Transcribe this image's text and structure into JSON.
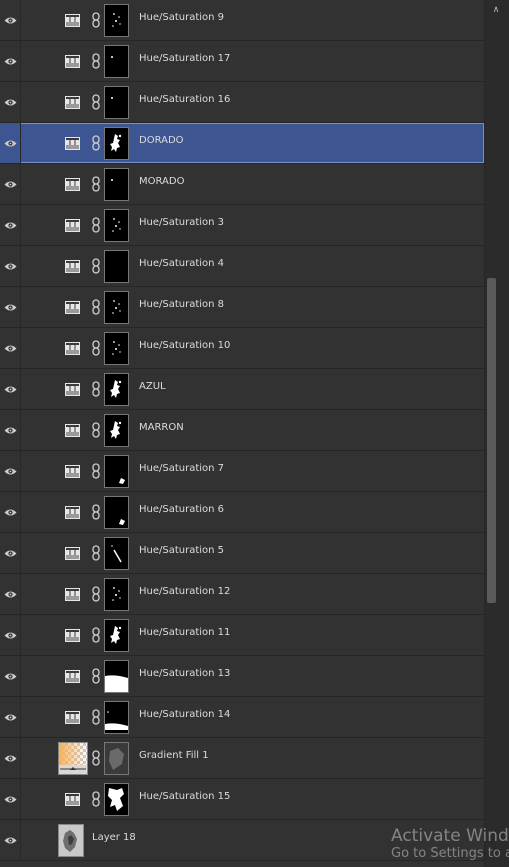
{
  "layers": [
    {
      "name": "Hue/Saturation 9",
      "kind": "adjustment",
      "selected": false,
      "mask": "specks"
    },
    {
      "name": "Hue/Saturation 17",
      "kind": "adjustment",
      "selected": false,
      "mask": "dot"
    },
    {
      "name": "Hue/Saturation 16",
      "kind": "adjustment",
      "selected": false,
      "mask": "dot"
    },
    {
      "name": "DORADO",
      "kind": "adjustment",
      "selected": true,
      "mask": "figure"
    },
    {
      "name": "MORADO",
      "kind": "adjustment",
      "selected": false,
      "mask": "dot"
    },
    {
      "name": "Hue/Saturation 3",
      "kind": "adjustment",
      "selected": false,
      "mask": "specks"
    },
    {
      "name": "Hue/Saturation 4",
      "kind": "adjustment",
      "selected": false,
      "mask": "none"
    },
    {
      "name": "Hue/Saturation 8",
      "kind": "adjustment",
      "selected": false,
      "mask": "specks"
    },
    {
      "name": "Hue/Saturation 10",
      "kind": "adjustment",
      "selected": false,
      "mask": "specks"
    },
    {
      "name": "AZUL",
      "kind": "adjustment",
      "selected": false,
      "mask": "figure"
    },
    {
      "name": "MARRON",
      "kind": "adjustment",
      "selected": false,
      "mask": "figure"
    },
    {
      "name": "Hue/Saturation 7",
      "kind": "adjustment",
      "selected": false,
      "mask": "corner"
    },
    {
      "name": "Hue/Saturation 6",
      "kind": "adjustment",
      "selected": false,
      "mask": "corner"
    },
    {
      "name": "Hue/Saturation 5",
      "kind": "adjustment",
      "selected": false,
      "mask": "stroke"
    },
    {
      "name": "Hue/Saturation 12",
      "kind": "adjustment",
      "selected": false,
      "mask": "specks"
    },
    {
      "name": "Hue/Saturation 11",
      "kind": "adjustment",
      "selected": false,
      "mask": "figure"
    },
    {
      "name": "Hue/Saturation 13",
      "kind": "adjustment",
      "selected": false,
      "mask": "bottom-fill"
    },
    {
      "name": "Hue/Saturation 14",
      "kind": "adjustment",
      "selected": false,
      "mask": "bottom-band"
    },
    {
      "name": "Gradient Fill 1",
      "kind": "gradient",
      "selected": false,
      "mask": "gray"
    },
    {
      "name": "Hue/Saturation 15",
      "kind": "adjustment",
      "selected": false,
      "mask": "white-figure"
    },
    {
      "name": "Layer 18",
      "kind": "pixel",
      "selected": false,
      "mask": "none"
    }
  ],
  "icons": {
    "visibility": "eye-icon",
    "adjustment": "hue-saturation-adjustment-icon",
    "link": "chain-link-icon",
    "scroll_up": "chevron-up-icon"
  },
  "colors": {
    "panel": "#323232",
    "selected_row": "#3d5590",
    "text": "#dcdcdc",
    "gradient_orange": "#f7b25c"
  },
  "watermark": {
    "title": "Activate Wind",
    "subtitle": "Go to Settings to a"
  }
}
